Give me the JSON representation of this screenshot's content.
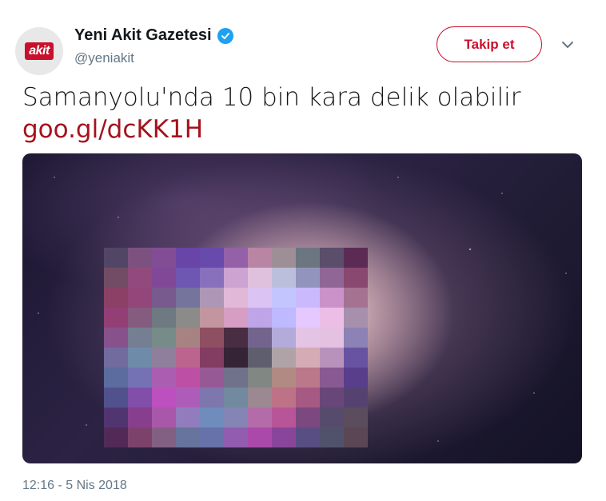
{
  "account": {
    "display_name": "Yeni Akit Gazetesi",
    "handle": "@yeniakit",
    "avatar_logo_text": "akit",
    "verified": true
  },
  "follow_button": {
    "label": "Takip et"
  },
  "tweet": {
    "text": "Samanyolu'nda 10 bin kara delik olabilir",
    "link": "goo.gl/dcKK1H",
    "timestamp": "12:16 - 5 Nis 2018"
  },
  "colors": {
    "brand_red": "#c8102e",
    "link_red": "#a4131e",
    "muted": "#657786",
    "verified_blue": "#1da1f2"
  },
  "icons": [
    "verified-badge-icon",
    "chevron-down-icon"
  ]
}
